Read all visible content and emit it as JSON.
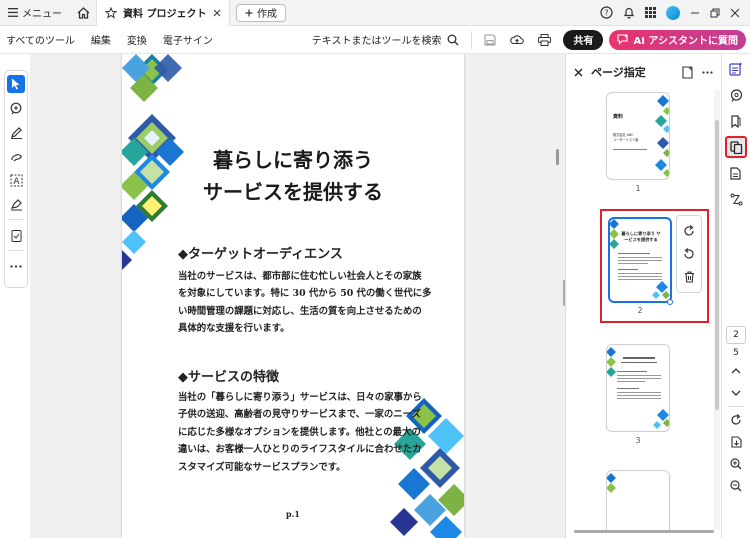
{
  "titlebar": {
    "menu_label": "メニュー",
    "tab_title": "資料 プロジェクト",
    "create_label": "作成"
  },
  "toolbar": {
    "menu_items": [
      "すべてのツール",
      "編集",
      "変換",
      "電子サイン"
    ],
    "search_label": "テキストまたはツールを検索",
    "share_label": "共有",
    "ai_label": "AI アシスタントに質問"
  },
  "document": {
    "title_line1": "暮らしに寄り添う",
    "title_line2": "サービスを提供する",
    "section1_heading": "◆ターゲットオーディエンス",
    "section1_lines": [
      "当社のサービスは、都市部に住む忙しい社会人とその家族",
      "を対象にしています。特に 30 代から 50 代の働く世代に多",
      "い時間管理の課題に対応し、生活の質を向上させるための",
      "具体的な支援を行います。"
    ],
    "section2_heading": "◆サービスの特徴",
    "section2_lines": [
      "当社の「暮らしに寄り添う」サービスは、日々の家事から",
      "子供の送迎、高齢者の見守りサービスまで、一家のニーズ",
      "に応じた多様なオプションを提供します。他社との最大の",
      "違いは、お客様一人ひとりのライフスタイルに合わせたカ",
      "スタマイズ可能なサービスプランです。"
    ],
    "page_label": "p.1"
  },
  "panel": {
    "title": "ページ指定",
    "thumbnails": [
      {
        "label": "1",
        "title": "資料",
        "lines": [
          "株式会社 ABC",
          "ユーザーリスト版"
        ]
      },
      {
        "label": "2",
        "title": "暮らしに寄り添う サービスを提供する"
      },
      {
        "label": "3"
      }
    ]
  },
  "navigation": {
    "current_page": "2",
    "total_pages": "5"
  },
  "colors": {
    "accent": "#1473e6",
    "highlight": "#e0202a",
    "ai_gradient_start": "#e8336d",
    "ai_gradient_end": "#c23d96",
    "share_bg": "#1a1a1a"
  }
}
